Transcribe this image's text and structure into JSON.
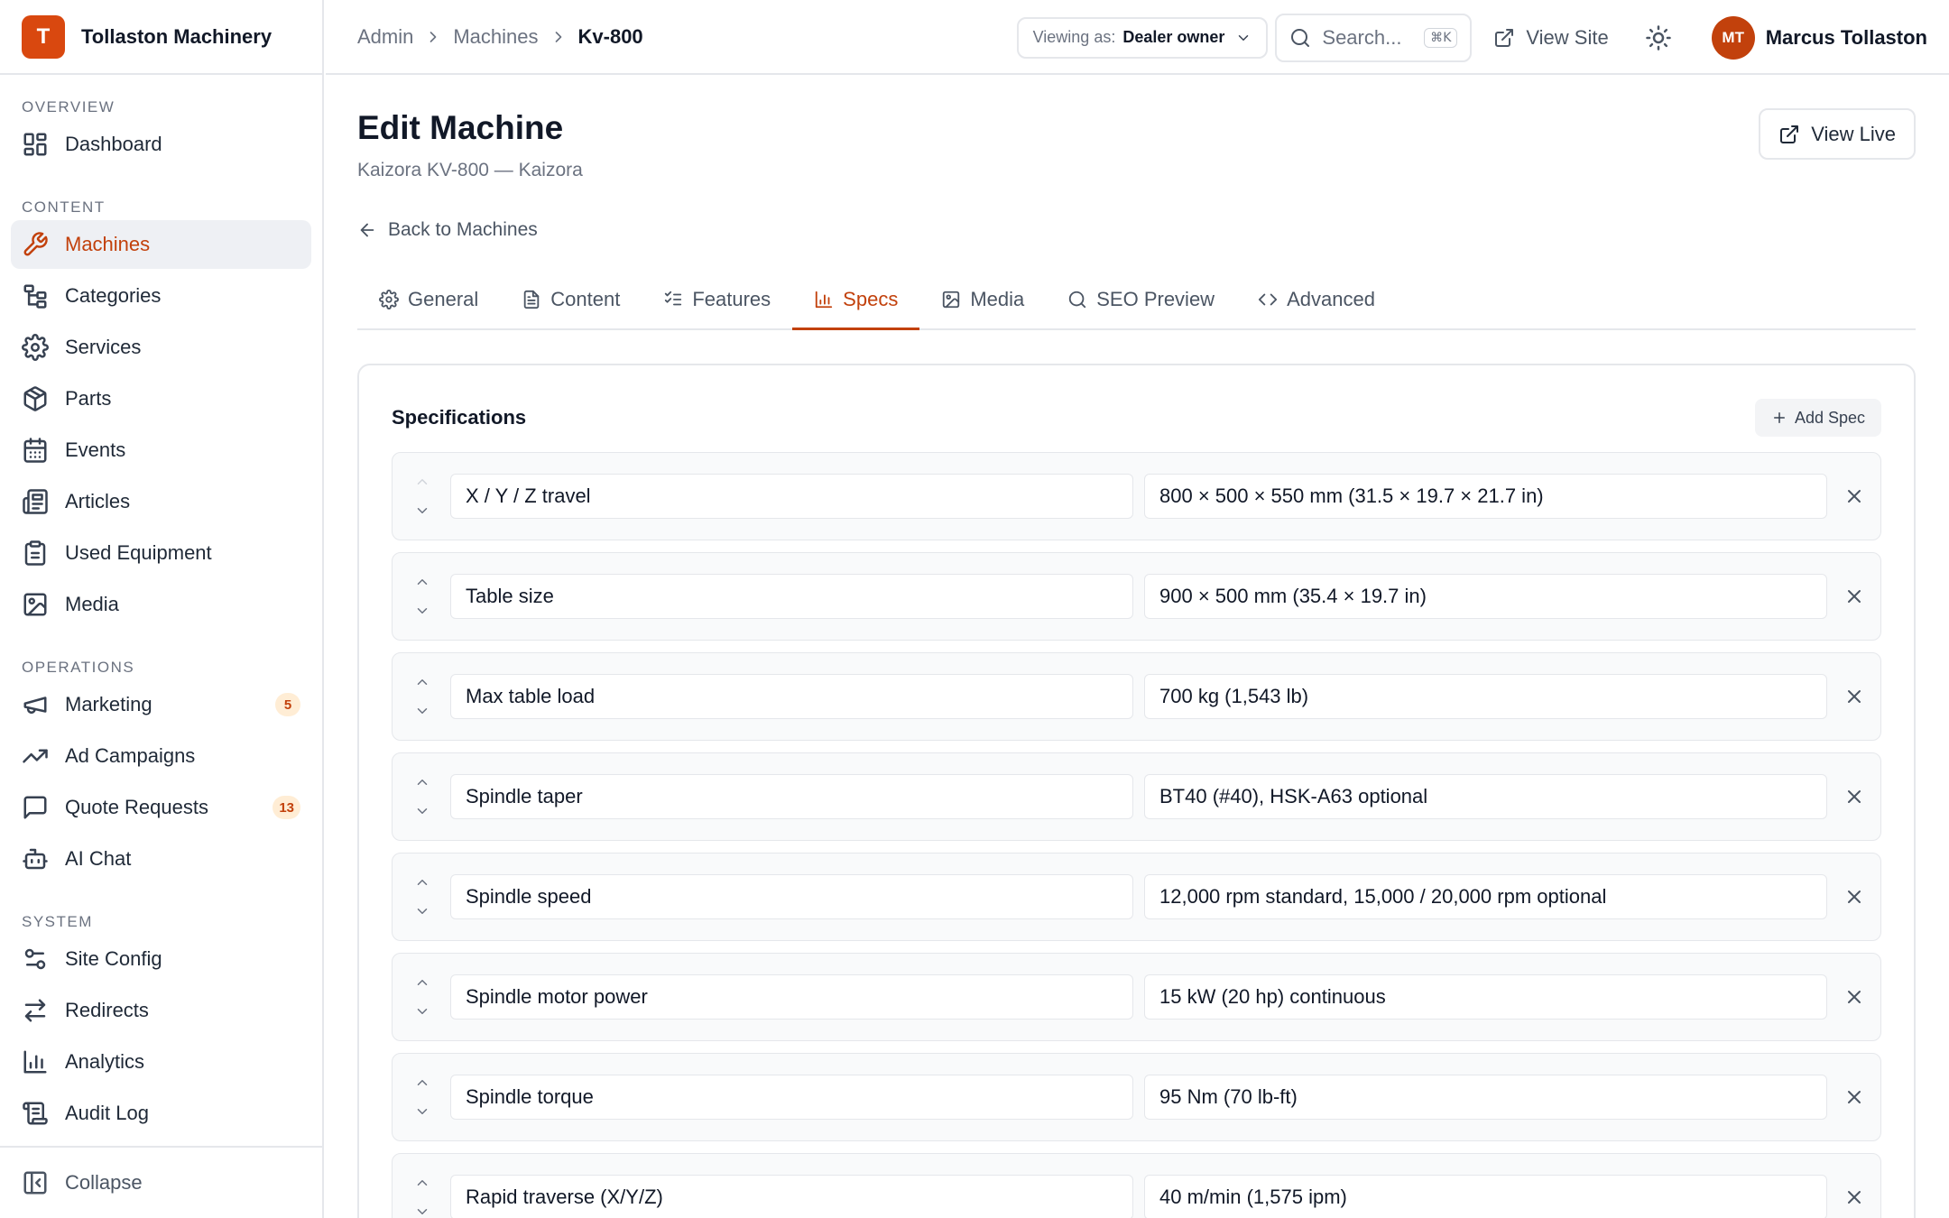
{
  "brand": {
    "initial": "T",
    "name": "Tollaston Machinery"
  },
  "sidebar": {
    "sections": [
      {
        "label": "OVERVIEW",
        "items": [
          {
            "label": "Dashboard",
            "icon": "dashboard-icon"
          }
        ]
      },
      {
        "label": "CONTENT",
        "items": [
          {
            "label": "Machines",
            "icon": "wrench-icon",
            "active": true
          },
          {
            "label": "Categories",
            "icon": "hierarchy-icon"
          },
          {
            "label": "Services",
            "icon": "gear-icon"
          },
          {
            "label": "Parts",
            "icon": "package-icon"
          },
          {
            "label": "Events",
            "icon": "calendar-icon"
          },
          {
            "label": "Articles",
            "icon": "newspaper-icon"
          },
          {
            "label": "Used Equipment",
            "icon": "clipboard-icon"
          },
          {
            "label": "Media",
            "icon": "image-icon"
          }
        ]
      },
      {
        "label": "OPERATIONS",
        "items": [
          {
            "label": "Marketing",
            "icon": "megaphone-icon",
            "badge": "5"
          },
          {
            "label": "Ad Campaigns",
            "icon": "trending-up-icon"
          },
          {
            "label": "Quote Requests",
            "icon": "message-icon",
            "badge": "13"
          },
          {
            "label": "AI Chat",
            "icon": "bot-icon"
          }
        ]
      },
      {
        "label": "SYSTEM",
        "items": [
          {
            "label": "Site Config",
            "icon": "sliders-icon"
          },
          {
            "label": "Redirects",
            "icon": "arrows-swap-icon"
          },
          {
            "label": "Analytics",
            "icon": "bar-chart-icon"
          },
          {
            "label": "Audit Log",
            "icon": "scroll-icon"
          }
        ]
      }
    ],
    "collapse_label": "Collapse"
  },
  "topbar": {
    "breadcrumb": [
      "Admin",
      "Machines",
      "Kv-800"
    ],
    "viewing_label": "Viewing as:",
    "viewing_value": "Dealer owner",
    "search_placeholder": "Search...",
    "search_shortcut": "⌘K",
    "view_site": "View Site",
    "user_initials": "MT",
    "user_name": "Marcus Tollaston"
  },
  "page": {
    "title": "Edit Machine",
    "subtitle": "Kaizora KV-800 — Kaizora",
    "view_live": "View Live",
    "back_label": "Back to Machines"
  },
  "tabs": [
    {
      "label": "General",
      "icon": "gear-icon"
    },
    {
      "label": "Content",
      "icon": "document-icon"
    },
    {
      "label": "Features",
      "icon": "checklist-icon"
    },
    {
      "label": "Specs",
      "icon": "bar-chart-icon",
      "active": true
    },
    {
      "label": "Media",
      "icon": "image-icon"
    },
    {
      "label": "SEO Preview",
      "icon": "search-icon"
    },
    {
      "label": "Advanced",
      "icon": "code-icon"
    }
  ],
  "specs": {
    "title": "Specifications",
    "add_label": "Add Spec",
    "rows": [
      {
        "key": "X / Y / Z travel",
        "value": "800 × 500 × 550 mm (31.5 × 19.7 × 21.7 in)"
      },
      {
        "key": "Table size",
        "value": "900 × 500 mm (35.4 × 19.7 in)"
      },
      {
        "key": "Max table load",
        "value": "700 kg (1,543 lb)"
      },
      {
        "key": "Spindle taper",
        "value": "BT40 (#40), HSK-A63 optional"
      },
      {
        "key": "Spindle speed",
        "value": "12,000 rpm standard, 15,000 / 20,000 rpm optional"
      },
      {
        "key": "Spindle motor power",
        "value": "15 kW (20 hp) continuous"
      },
      {
        "key": "Spindle torque",
        "value": "95 Nm (70 lb-ft)"
      },
      {
        "key": "Rapid traverse (X/Y/Z)",
        "value": "40 m/min (1,575 ipm)"
      }
    ]
  },
  "colors": {
    "accent": "#c2410c",
    "brand": "#d9480f"
  }
}
